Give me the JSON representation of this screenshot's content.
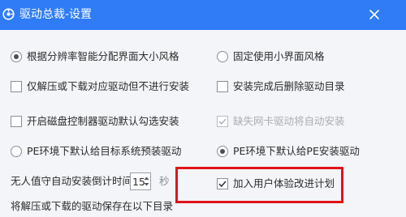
{
  "window": {
    "title": "驱动总裁-设置"
  },
  "options": {
    "ui_auto_size": "根据分辨率智能分配界面大小风格",
    "ui_small_fixed": "固定使用小界面风格",
    "extract_download_no_install": "仅解压或下载对应驱动但不进行安装",
    "delete_driver_dir_after_install": "安装完成后删除驱动目录",
    "disk_controller_default_checked": "开启磁盘控制器驱动默认勾选安装",
    "missing_nic_auto_install": "缺失网卡驱动将自动安装",
    "pe_target_preinstall": "PE环境下默认给目标系统预装驱动",
    "pe_install_for_pe": "PE环境下默认给PE安装驱动"
  },
  "unattended": {
    "label": "无人值守自动安装倒计时间:",
    "value": "15",
    "unit": "秒"
  },
  "ux_program": {
    "label": "加入用户体验改进计划"
  },
  "save_dir": {
    "label": "将解压或下载的驱动保存在以下目录"
  },
  "colors": {
    "titlebar": "#2f7cf6",
    "highlight": "#e0131b"
  }
}
